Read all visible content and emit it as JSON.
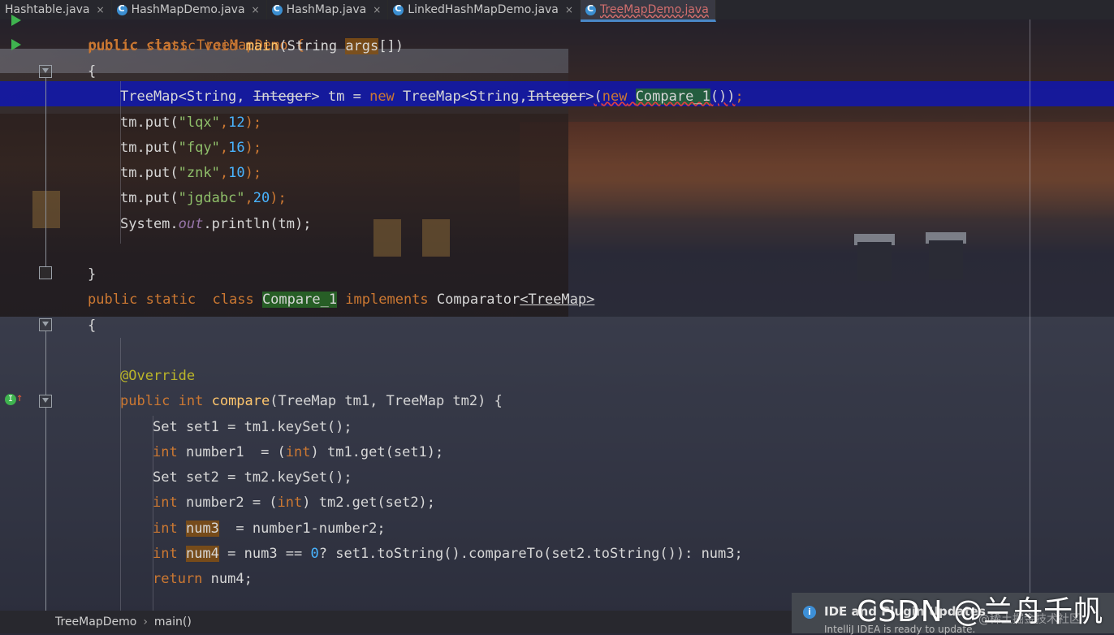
{
  "tabs": [
    {
      "label": "Hashtable.java",
      "active": false,
      "icon": "class-icon"
    },
    {
      "label": "HashMapDemo.java",
      "active": false,
      "icon": "class-icon"
    },
    {
      "label": "HashMap.java",
      "active": false,
      "icon": "class-icon"
    },
    {
      "label": "LinkedHashMapDemo.java",
      "active": false,
      "icon": "class-icon"
    },
    {
      "label": "TreeMapDemo.java",
      "active": true,
      "icon": "class-icon"
    }
  ],
  "tab_close_glyph": "×",
  "code": {
    "line0": "public class TreeMapDemo {",
    "main_sig": {
      "kw": "public static void ",
      "fn": "main",
      "p1": "(String ",
      "arg": "args",
      "p2": "[])"
    },
    "brace_open": "{",
    "tm_decl": {
      "a": "TreeMap<String, ",
      "b": "Integer",
      "c": "> tm = ",
      "new1": "new",
      "d": " TreeMap<String,",
      "e": "Integer",
      "f": ">",
      "g": "(",
      "new2": "new",
      "h": " ",
      "cls": "Compare_1",
      "i": "())",
      "j": ";"
    },
    "put1": {
      "a": "tm.put(",
      "s": "\"lqx\"",
      "b": ",",
      "n": "12",
      "c": ");"
    },
    "put2": {
      "a": "tm.put(",
      "s": "\"fqy\"",
      "b": ",",
      "n": "16",
      "c": ");"
    },
    "put3": {
      "a": "tm.put(",
      "s": "\"znk\"",
      "b": ",",
      "n": "10",
      "c": ");"
    },
    "put4": {
      "a": "tm.put(",
      "s": "\"jgdabc\"",
      "b": ",",
      "n": "20",
      "c": ");"
    },
    "println": {
      "a": "System.",
      "out": "out",
      "b": ".println(tm);"
    },
    "brace_close": "}",
    "class_sig": {
      "kw1": "public static  class ",
      "cls": "Compare_1",
      "kw2": " implements ",
      "c": "Comparator",
      "gen": "<TreeMap>"
    },
    "brace_open2": "{",
    "override": "@Override",
    "compare_sig": {
      "kw": "public int ",
      "fn": "compare",
      "rest": "(TreeMap tm1, TreeMap tm2) {"
    },
    "l_set1": "Set set1 = tm1.keySet();",
    "l_num1": {
      "kw": "int",
      "a": " number1  = (",
      "kw2": "int",
      "b": ") tm1.get(set1);"
    },
    "l_set2": "Set set2 = tm2.keySet();",
    "l_num2": {
      "kw": "int",
      "a": " number2 = (",
      "kw2": "int",
      "b": ") tm2.get(set2);"
    },
    "l_num3": {
      "kw": "int",
      "a": " ",
      "v": "num3",
      "b": "  = number1-number2;"
    },
    "l_num4": {
      "kw": "int",
      "a": " ",
      "v": "num4",
      "b": " = num3 == ",
      "n": "0",
      "c": "? set1.toString().compareTo(set2.toString()): num3;"
    },
    "l_ret": {
      "kw": "return",
      "a": " num4;"
    }
  },
  "breadcrumb": {
    "cls": "TreeMapDemo",
    "sep": "›",
    "method": "main()"
  },
  "notification": {
    "title": "IDE and Plugin Updates",
    "sub": "IntelliJ IDEA is ready to update."
  },
  "watermark": "CSDN @兰舟千帆",
  "watermark2": "@稀土掘金技术社区",
  "colors": {
    "keyword": "#cc7832",
    "function": "#ffc66d",
    "string": "#8fbf6a",
    "number": "#49b4ff",
    "annotation": "#bbb529",
    "highlight_row": "#0a14c8"
  }
}
